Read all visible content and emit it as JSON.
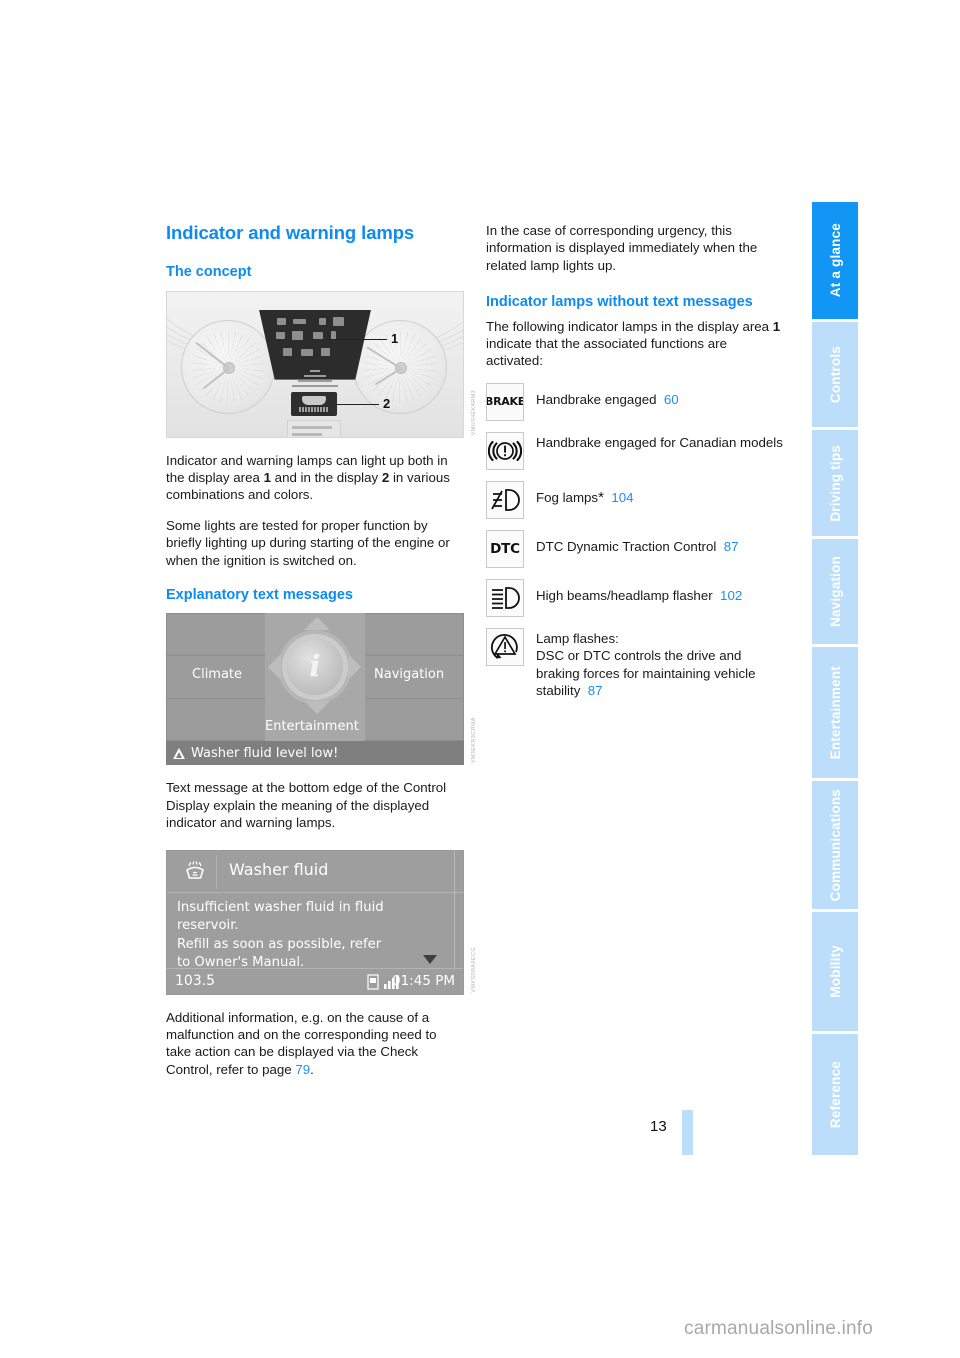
{
  "document": {
    "page_number": "13",
    "watermark": "carmanualsonline.info"
  },
  "sidebar": {
    "tabs": [
      {
        "label": "At a glance",
        "active": true
      },
      {
        "label": "Controls",
        "active": false
      },
      {
        "label": "Driving tips",
        "active": false
      },
      {
        "label": "Navigation",
        "active": false
      },
      {
        "label": "Entertainment",
        "active": false
      },
      {
        "label": "Communications",
        "active": false
      },
      {
        "label": "Mobility",
        "active": false
      },
      {
        "label": "Reference",
        "active": false
      }
    ],
    "active_color": "#1296f5",
    "inactive_color": "#bcdefb"
  },
  "left_column": {
    "title": "Indicator and warning lamps",
    "concept_heading": "The concept",
    "figure_cluster": {
      "callout_1": "1",
      "callout_2": "2",
      "code": "VMUS4EK4RM3"
    },
    "para_1_a": "Indicator and warning lamps can light up both in the display area ",
    "para_1_b": "1",
    "para_1_c": " and in the display ",
    "para_1_d": "2",
    "para_1_e": " in various combinations and colors.",
    "para_2": "Some lights are tested for proper function by briefly lighting up during starting of the engine or when the ignition is switched on.",
    "explanatory_heading": "Explanatory text messages",
    "figure_idrive": {
      "climate": "Climate",
      "navigation": "Navigation",
      "entertainment": "Entertainment",
      "status_message": "Washer fluid level low!",
      "code": "VM3EKR3CRMA"
    },
    "para_3": "Text message at the bottom edge of the Control Display explain the meaning of the displayed indicator and warning lamps.",
    "figure_checkcontrol": {
      "title": "Washer fluid",
      "body_line_1": "Insufficient washer fluid in fluid",
      "body_line_2": "reservoir.",
      "body_line_3": "Refill as soon as possible, refer",
      "body_line_4": "to Owner's Manual.",
      "frequency": "103.5",
      "time": "01:45 PM",
      "code": "VMXS0RA9ECG"
    },
    "para_4_a": "Additional information, e.g. on the cause of a malfunction and on the corresponding need to take action can be displayed via the Check Control, refer to page ",
    "para_4_ref": "79",
    "para_4_b": "."
  },
  "right_column": {
    "para_1": "In the case of corresponding urgency, this information is displayed immediately when the related lamp lights up.",
    "heading": "Indicator lamps without text messages",
    "para_2_a": "The following indicator lamps in the display area ",
    "para_2_b": "1",
    "para_2_c": " indicate that the associated functions are activated:",
    "lamps": [
      {
        "icon": "brake-text-icon",
        "icon_label": "BRAKE",
        "text": "Handbrake engaged",
        "page_ref": "60",
        "has_star": false
      },
      {
        "icon": "brake-exclamation-circle-icon",
        "icon_label": "",
        "text": "Handbrake engaged for Canadian models",
        "page_ref": "",
        "has_star": false
      },
      {
        "icon": "fog-lamp-icon",
        "icon_label": "",
        "text": "Fog lamps",
        "page_ref": "104",
        "has_star": true
      },
      {
        "icon": "dtc-text-icon",
        "icon_label": "DTC",
        "text": "DTC Dynamic Traction Control",
        "page_ref": "87",
        "has_star": false
      },
      {
        "icon": "high-beam-icon",
        "icon_label": "",
        "text": "High beams/headlamp flasher",
        "page_ref": "102",
        "has_star": false
      },
      {
        "icon": "dsc-triangle-icon",
        "icon_label": "",
        "text": "Lamp flashes:\nDSC or DTC controls the drive and braking forces for maintaining vehicle stability",
        "page_ref": "87",
        "has_star": false
      }
    ]
  },
  "colors": {
    "heading_blue": "#0d8bf2",
    "link_blue": "#1f8ef1",
    "tab_active": "#1296f5",
    "tab_inactive": "#bcdefb",
    "body_text": "#1a1a1a"
  }
}
